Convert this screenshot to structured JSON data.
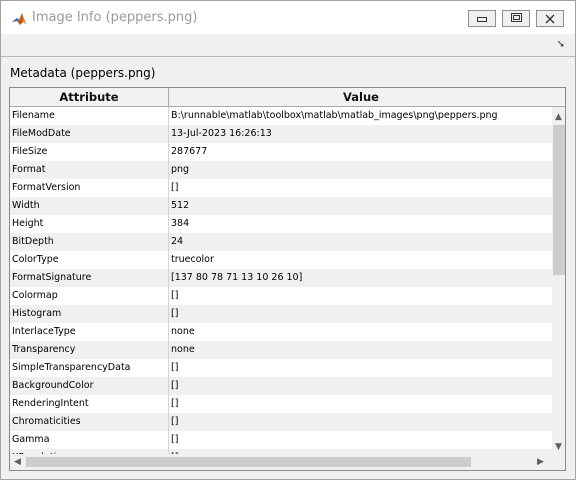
{
  "window": {
    "title": "Image Info (peppers.png)",
    "icon": "matlab-icon"
  },
  "toolbar": {
    "dock_icon": "dock-arrow-icon",
    "dock_glyph": "➘"
  },
  "metadata_label": "Metadata (peppers.png)",
  "table": {
    "columns": [
      "Attribute",
      "Value"
    ],
    "rows": [
      {
        "attr": "Filename",
        "value": "B:\\runnable\\matlab\\toolbox\\matlab\\matlab_images\\png\\peppers.png"
      },
      {
        "attr": "FileModDate",
        "value": "13-Jul-2023 16:26:13"
      },
      {
        "attr": "FileSize",
        "value": "287677"
      },
      {
        "attr": "Format",
        "value": "png"
      },
      {
        "attr": "FormatVersion",
        "value": "[]"
      },
      {
        "attr": "Width",
        "value": "512"
      },
      {
        "attr": "Height",
        "value": "384"
      },
      {
        "attr": "BitDepth",
        "value": "24"
      },
      {
        "attr": "ColorType",
        "value": "truecolor"
      },
      {
        "attr": "FormatSignature",
        "value": "[137 80 78 71 13 10 26 10]"
      },
      {
        "attr": "Colormap",
        "value": "[]"
      },
      {
        "attr": "Histogram",
        "value": "[]"
      },
      {
        "attr": "InterlaceType",
        "value": "none"
      },
      {
        "attr": "Transparency",
        "value": "none"
      },
      {
        "attr": "SimpleTransparencyData",
        "value": "[]"
      },
      {
        "attr": "BackgroundColor",
        "value": "[]"
      },
      {
        "attr": "RenderingIntent",
        "value": "[]"
      },
      {
        "attr": "Chromaticities",
        "value": "[]"
      },
      {
        "attr": "Gamma",
        "value": "[]"
      },
      {
        "attr": "XResolution",
        "value": "[]"
      }
    ]
  },
  "colors": {
    "title_text": "#9a9a9a",
    "row_alt": "#f0f0f0",
    "header_bg": "#f2f2f2",
    "scrollbar_thumb": "#cdcdcd"
  }
}
